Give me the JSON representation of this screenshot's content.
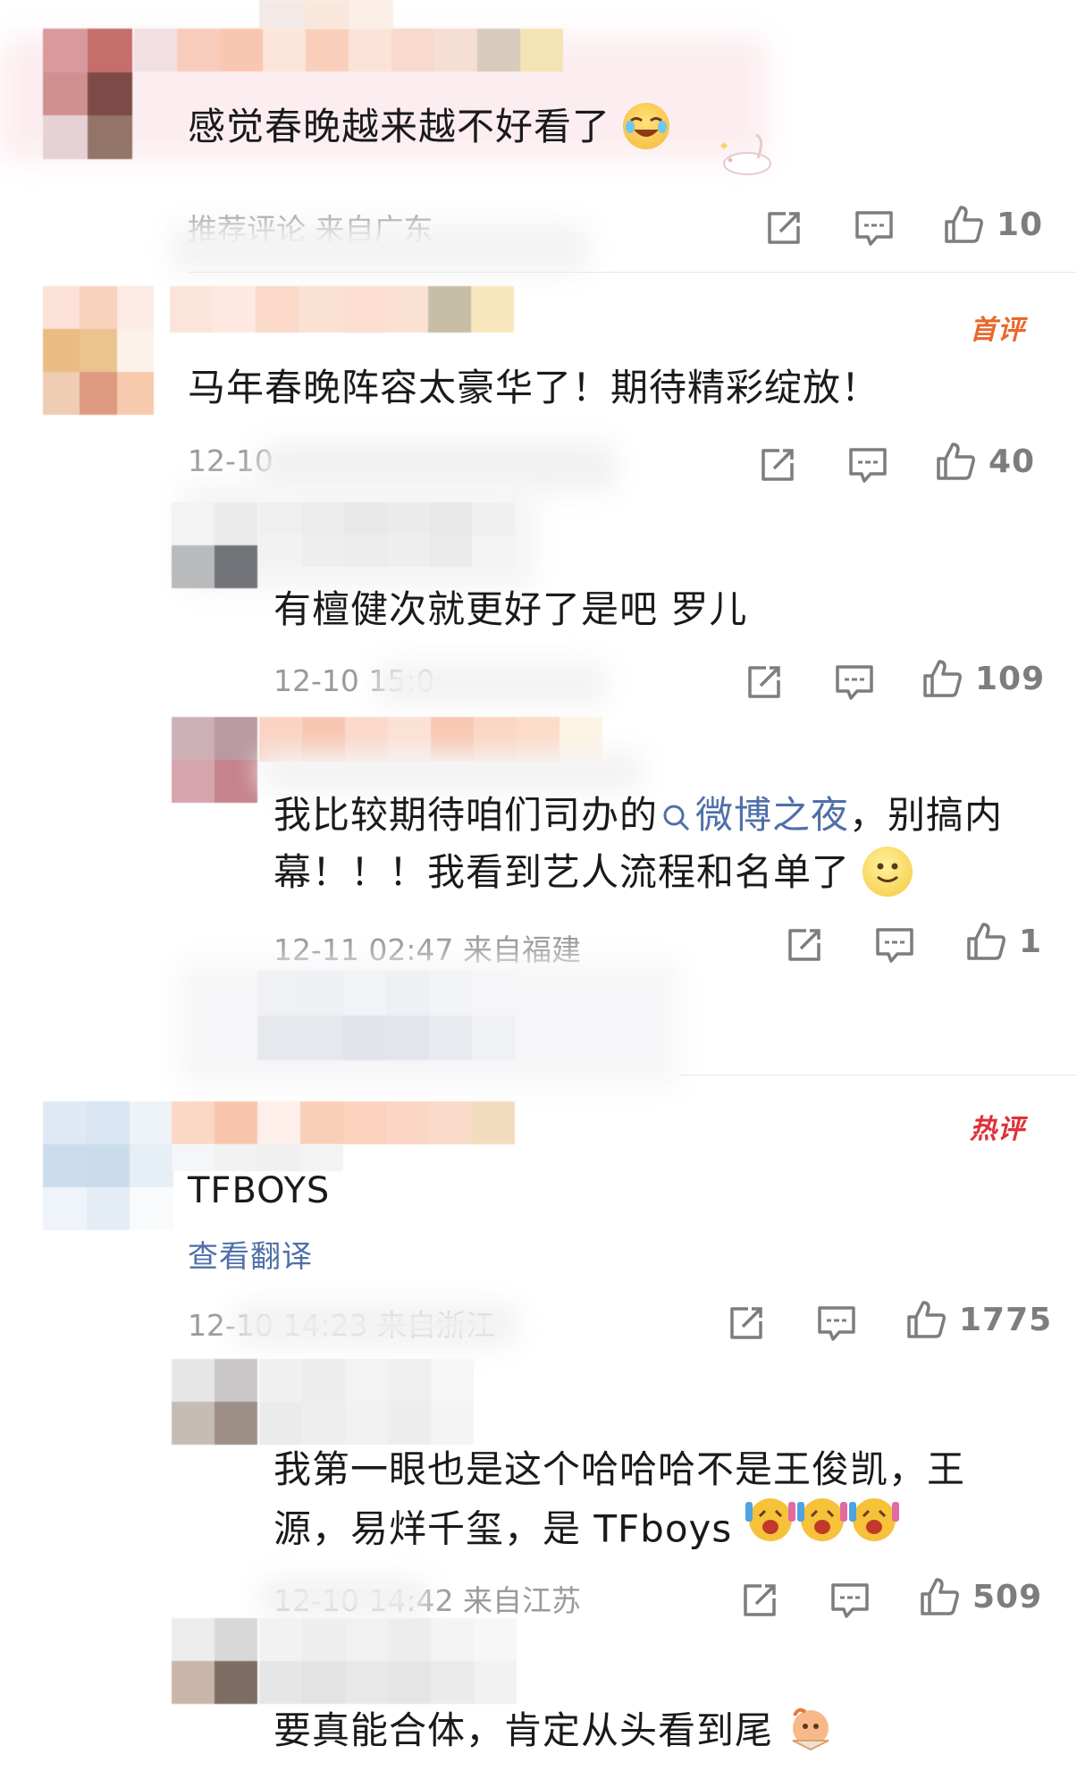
{
  "comments": [
    {
      "text": "感觉春晚越来越不好看了",
      "meta": "推荐评论 来自广东",
      "likes": "10"
    },
    {
      "badge": "首评",
      "text": "马年春晚阵容太豪华了！期待精彩绽放！",
      "meta": "12-10",
      "likes": "40",
      "replies": [
        {
          "text": "有檀健次就更好了是吧  罗儿",
          "meta": "12-10 15:0",
          "likes": "109"
        },
        {
          "text_prefix": "我比较期待咱们司办的",
          "topic": "微博之夜",
          "text_suffix": "，别搞内",
          "text_line2": "幕！！！我看到艺人流程和名单了",
          "meta": "12-11 02:47 来自福建",
          "likes": "1"
        }
      ]
    },
    {
      "badge": "热评",
      "text": "TFBOYS",
      "translate": "查看翻译",
      "meta": "12-10 14:23 来自浙江",
      "likes": "1775",
      "replies": [
        {
          "text_line1": "我第一眼也是这个哈哈哈不是王俊凯，王",
          "text_line2": "源，易烊千玺，是 TFboys",
          "meta": "12-10 14:42 来自江苏",
          "likes": "509"
        },
        {
          "text": "要真能合体，肯定从头看到尾"
        }
      ]
    }
  ],
  "icons": [
    "repost-icon",
    "comment-icon",
    "like-icon",
    "search-icon",
    "laugh-cry-emoji",
    "smile-emoji",
    "excited-emoji"
  ],
  "colors": {
    "badge": "#e8682e",
    "hot_badge": "#e0303a",
    "link": "#4f6fa8",
    "meta": "#9a9a9a"
  }
}
